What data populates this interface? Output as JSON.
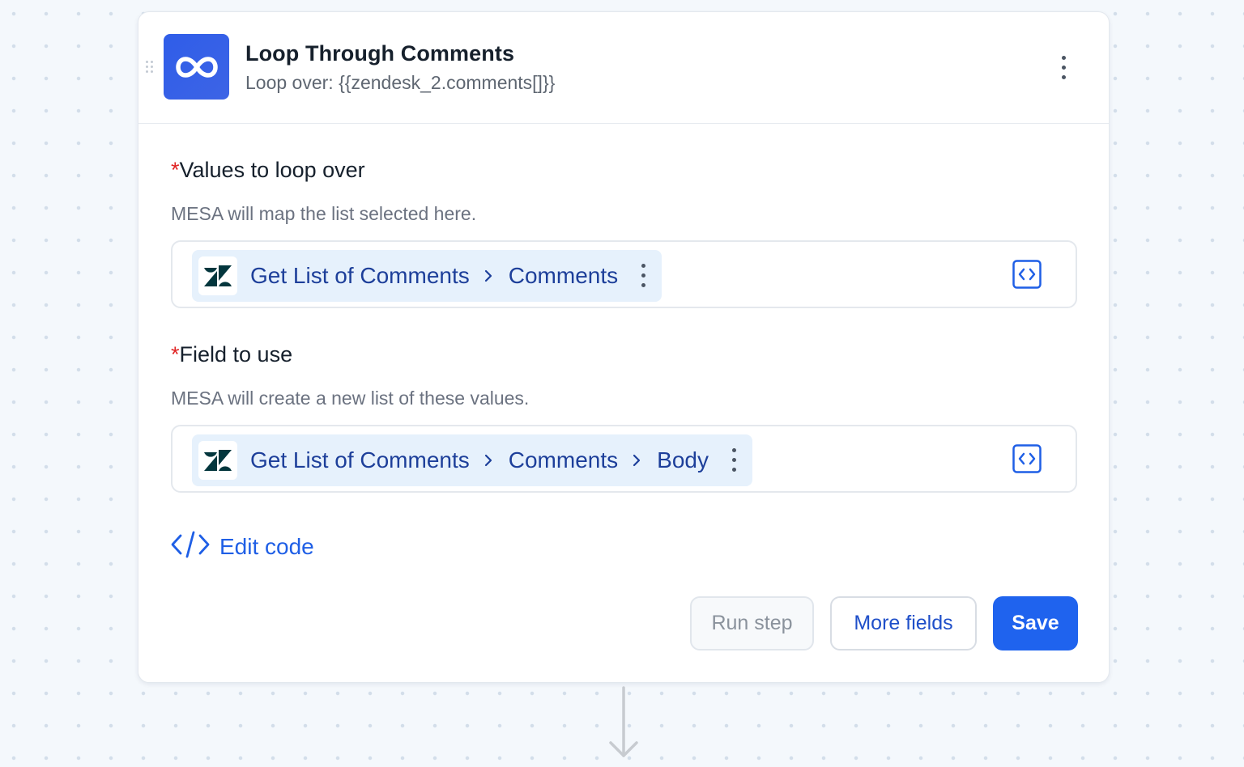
{
  "step": {
    "title": "Loop Through Comments",
    "subtitle": "Loop over: {{zendesk_2.comments[]}}",
    "icon": "infinity-loop-icon",
    "accent": "#2f5de8"
  },
  "fields": [
    {
      "required_mark": "*",
      "label": "Values to loop over",
      "help": "MESA will map the list selected here.",
      "path": [
        "Get List of Comments",
        "Comments"
      ],
      "app_icon": "zendesk-logo-icon"
    },
    {
      "required_mark": "*",
      "label": "Field to use",
      "help": "MESA will create a new list of these values.",
      "path": [
        "Get List of Comments",
        "Comments",
        "Body"
      ],
      "app_icon": "zendesk-logo-icon"
    }
  ],
  "edit_code": {
    "label": "Edit code",
    "icon": "code-icon"
  },
  "buttons": {
    "run_step": "Run step",
    "more_fields": "More fields",
    "save": "Save"
  },
  "colors": {
    "primary": "#1f63ee",
    "token_bg": "#e6f1fc",
    "token_text": "#1d3f9a",
    "required": "#e02424"
  }
}
